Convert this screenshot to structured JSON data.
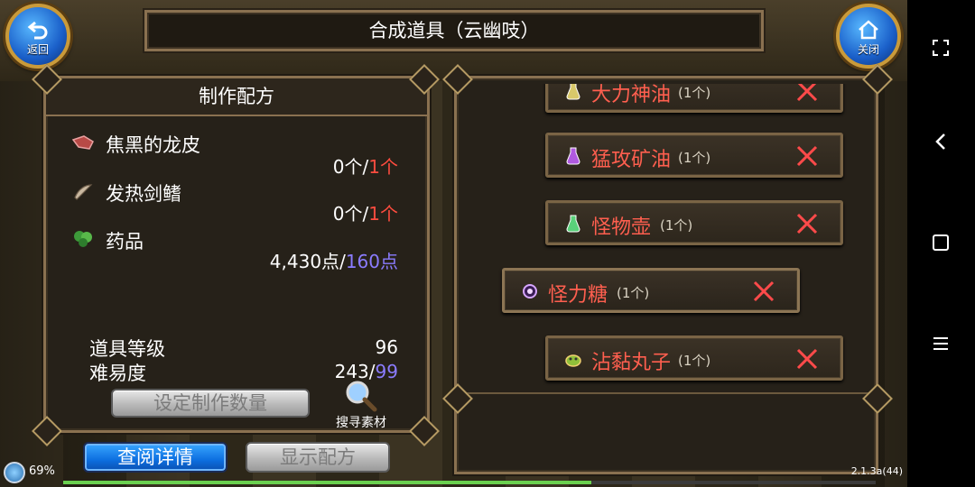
{
  "header": {
    "title": "合成道具（云幽吱）",
    "back_label": "返回",
    "close_label": "关闭"
  },
  "recipe": {
    "heading": "制作配方",
    "materials": [
      {
        "name": "焦黑的龙皮",
        "have": "0个",
        "sep": "/",
        "need": "1个",
        "icon": "dragon-hide-icon"
      },
      {
        "name": "发热剑鳍",
        "have": "0个",
        "sep": "/",
        "need": "1个",
        "icon": "sword-fin-icon"
      },
      {
        "name": "药品",
        "have": "4,430点",
        "sep": "/",
        "need": "160点",
        "icon": "herb-icon"
      }
    ],
    "item_level_label": "道具等级",
    "item_level_value": "96",
    "difficulty_label": "难易度",
    "difficulty_value": "243",
    "difficulty_sep": "/",
    "difficulty_max": "99",
    "set_quantity_button": "设定制作数量",
    "search_label": "搜寻素材"
  },
  "bottom_buttons": {
    "view_details": "查阅详情",
    "show_recipe": "显示配方"
  },
  "ingredients": [
    {
      "name": "大力神油",
      "count": "(1个)",
      "icon": "potion-icon"
    },
    {
      "name": "猛攻矿油",
      "count": "(1个)",
      "icon": "potion-icon"
    },
    {
      "name": "怪物壶",
      "count": "(1个)",
      "icon": "potion-icon"
    },
    {
      "name": "怪力糖",
      "count": "(1个)",
      "icon": "candy-icon"
    },
    {
      "name": "沾黏丸子",
      "count": "(1个)",
      "icon": "dumpling-icon"
    }
  ],
  "status": {
    "battery_percent": "69%",
    "version": "2.1.3a(44)",
    "xp_progress": 0.65
  },
  "colors": {
    "accent_red": "#ff4c3f",
    "accent_blue": "#8b7cff",
    "frame_gold": "#8a7150"
  }
}
